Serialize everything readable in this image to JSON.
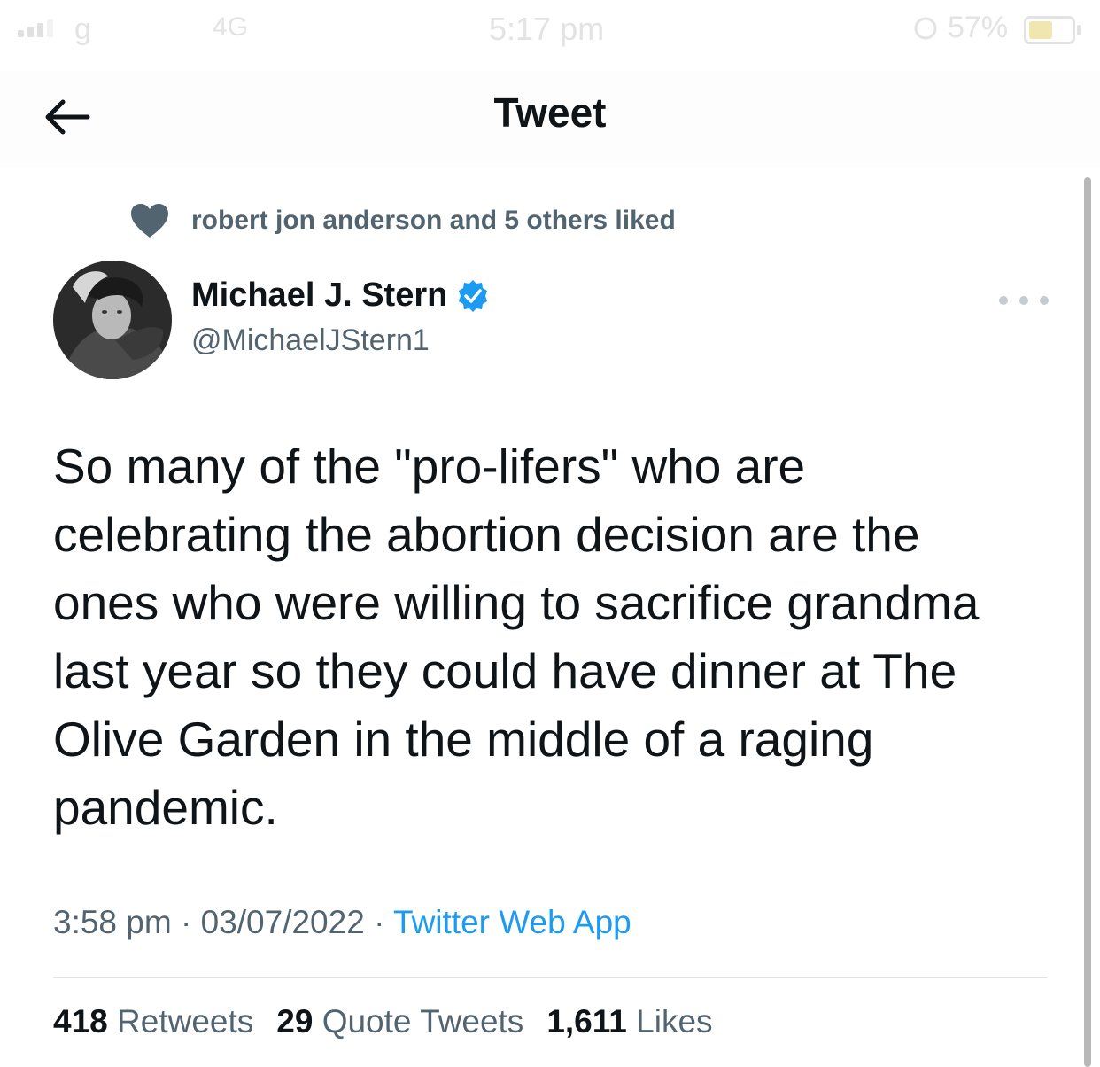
{
  "status_bar": {
    "carrier": "g",
    "network": "4G",
    "time": "5:17 pm",
    "battery_percent": "57%"
  },
  "nav": {
    "title": "Tweet",
    "back_icon": "arrow-left-icon"
  },
  "social_context": {
    "icon": "heart-icon",
    "text": "robert jon anderson and 5 others liked"
  },
  "author": {
    "display_name": "Michael J. Stern",
    "handle": "@MichaelJStern1",
    "verified": true,
    "verified_icon": "verified-badge-icon"
  },
  "tweet": {
    "text_lines": [
      "So many of the \"pro-lifers\" who are",
      "celebrating the abortion decision are the",
      "ones who were willing to sacrifice grandma",
      "last year so they could have dinner at The",
      "Olive Garden in the middle of a raging",
      "pandemic."
    ],
    "time": "3:58 pm",
    "separator": "·",
    "date": "03/07/2022",
    "source": "Twitter Web App"
  },
  "stats": {
    "retweets_count": "418",
    "retweets_label": "Retweets",
    "quotes_count": "29",
    "quotes_label": "Quote Tweets",
    "likes_count": "1,611",
    "likes_label": "Likes"
  },
  "colors": {
    "text_primary": "#0f1419",
    "text_secondary": "#536471",
    "accent": "#1d9bf0"
  }
}
